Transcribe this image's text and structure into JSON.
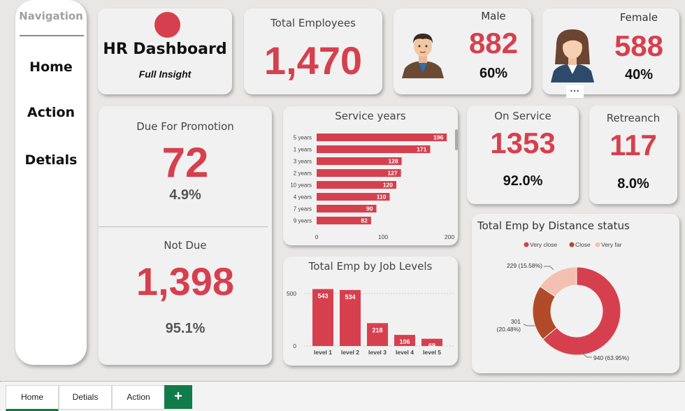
{
  "sidebar": {
    "title": "Navigation",
    "items": [
      {
        "label": "Home",
        "active": true
      },
      {
        "label": "Action",
        "active": false
      },
      {
        "label": "Detials",
        "active": false
      }
    ]
  },
  "header": {
    "title": "HR Dashboard",
    "subtitle": "Full Insight"
  },
  "kpis": {
    "total_employees": {
      "label": "Total Employees",
      "value": "1,470"
    },
    "male": {
      "label": "Male",
      "value": "882",
      "pct": "60%"
    },
    "female": {
      "label": "Female",
      "value": "588",
      "pct": "40%"
    },
    "due_promotion": {
      "label": "Due For Promotion",
      "value": "72",
      "pct": "4.9%"
    },
    "not_due": {
      "label": "Not Due",
      "value": "1,398",
      "pct": "95.1%"
    },
    "on_service": {
      "label": "On Service",
      "value": "1353",
      "pct": "92.0%"
    },
    "retreanch": {
      "label": "Retreanch",
      "value": "117",
      "pct": "8.0%"
    }
  },
  "more_options": "...",
  "colors": {
    "accent": "#d6404e",
    "close": "#b04a28",
    "very_far": "#f3c0b1",
    "tab_accent": "#117c49"
  },
  "chart_data": [
    {
      "type": "bar",
      "orientation": "horizontal",
      "title": "Service years",
      "categories": [
        "5 years",
        "1 years",
        "3 years",
        "2 years",
        "10 years",
        "4 years",
        "7 years",
        "9 years"
      ],
      "values": [
        196,
        171,
        128,
        127,
        120,
        110,
        90,
        82
      ],
      "xlim": [
        0,
        200
      ],
      "xticks": [
        0,
        100,
        200
      ]
    },
    {
      "type": "bar",
      "title": "Total Emp by Job Levels",
      "categories": [
        "level 1",
        "level 2",
        "level 3",
        "level 4",
        "level 5"
      ],
      "values": [
        543,
        534,
        218,
        106,
        69
      ],
      "yticks": [
        0,
        500
      ]
    },
    {
      "type": "pie",
      "donut": true,
      "title": "Total Emp by Distance status",
      "legend": [
        "Very close",
        "Close",
        "Very far"
      ],
      "legend_position": "top",
      "values": [
        940,
        301,
        229
      ],
      "labels": [
        "940 (63.95%)",
        "301 (20.48%)",
        "229 (15.58%)"
      ],
      "colors": [
        "#d6404e",
        "#b04a28",
        "#f3c0b1"
      ]
    }
  ],
  "tabs": [
    {
      "label": "Home",
      "active": true
    },
    {
      "label": "Detials",
      "active": false
    },
    {
      "label": "Action",
      "active": false
    }
  ],
  "add_tab_label": "+"
}
